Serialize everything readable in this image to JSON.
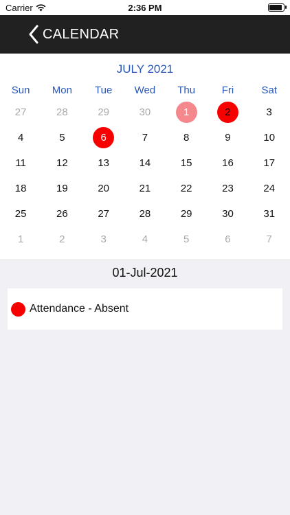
{
  "status": {
    "carrier": "Carrier",
    "time": "2:36 PM"
  },
  "header": {
    "title": "CALENDAR"
  },
  "calendar": {
    "month_title": "JULY 2021",
    "weekdays": [
      "Sun",
      "Mon",
      "Tue",
      "Wed",
      "Thu",
      "Fri",
      "Sat"
    ],
    "days": [
      {
        "label": "27",
        "muted": true,
        "mark": ""
      },
      {
        "label": "28",
        "muted": true,
        "mark": ""
      },
      {
        "label": "29",
        "muted": true,
        "mark": ""
      },
      {
        "label": "30",
        "muted": true,
        "mark": ""
      },
      {
        "label": "1",
        "muted": false,
        "mark": "light"
      },
      {
        "label": "2",
        "muted": false,
        "mark": "current"
      },
      {
        "label": "3",
        "muted": false,
        "mark": ""
      },
      {
        "label": "4",
        "muted": false,
        "mark": ""
      },
      {
        "label": "5",
        "muted": false,
        "mark": ""
      },
      {
        "label": "6",
        "muted": false,
        "mark": "absent"
      },
      {
        "label": "7",
        "muted": false,
        "mark": ""
      },
      {
        "label": "8",
        "muted": false,
        "mark": ""
      },
      {
        "label": "9",
        "muted": false,
        "mark": ""
      },
      {
        "label": "10",
        "muted": false,
        "mark": ""
      },
      {
        "label": "11",
        "muted": false,
        "mark": ""
      },
      {
        "label": "12",
        "muted": false,
        "mark": ""
      },
      {
        "label": "13",
        "muted": false,
        "mark": ""
      },
      {
        "label": "14",
        "muted": false,
        "mark": ""
      },
      {
        "label": "15",
        "muted": false,
        "mark": ""
      },
      {
        "label": "16",
        "muted": false,
        "mark": ""
      },
      {
        "label": "17",
        "muted": false,
        "mark": ""
      },
      {
        "label": "18",
        "muted": false,
        "mark": ""
      },
      {
        "label": "19",
        "muted": false,
        "mark": ""
      },
      {
        "label": "20",
        "muted": false,
        "mark": ""
      },
      {
        "label": "21",
        "muted": false,
        "mark": ""
      },
      {
        "label": "22",
        "muted": false,
        "mark": ""
      },
      {
        "label": "23",
        "muted": false,
        "mark": ""
      },
      {
        "label": "24",
        "muted": false,
        "mark": ""
      },
      {
        "label": "25",
        "muted": false,
        "mark": ""
      },
      {
        "label": "26",
        "muted": false,
        "mark": ""
      },
      {
        "label": "27",
        "muted": false,
        "mark": ""
      },
      {
        "label": "28",
        "muted": false,
        "mark": ""
      },
      {
        "label": "29",
        "muted": false,
        "mark": ""
      },
      {
        "label": "30",
        "muted": false,
        "mark": ""
      },
      {
        "label": "31",
        "muted": false,
        "mark": ""
      },
      {
        "label": "1",
        "muted": true,
        "mark": ""
      },
      {
        "label": "2",
        "muted": true,
        "mark": ""
      },
      {
        "label": "3",
        "muted": true,
        "mark": ""
      },
      {
        "label": "4",
        "muted": true,
        "mark": ""
      },
      {
        "label": "5",
        "muted": true,
        "mark": ""
      },
      {
        "label": "6",
        "muted": true,
        "mark": ""
      },
      {
        "label": "7",
        "muted": true,
        "mark": ""
      }
    ]
  },
  "selected": {
    "date": "01-Jul-2021",
    "events": [
      {
        "label": "Attendance - Absent",
        "color": "#f90000"
      }
    ]
  },
  "colors": {
    "accent": "#2957b8",
    "absent": "#f90000",
    "nav": "#212121"
  }
}
